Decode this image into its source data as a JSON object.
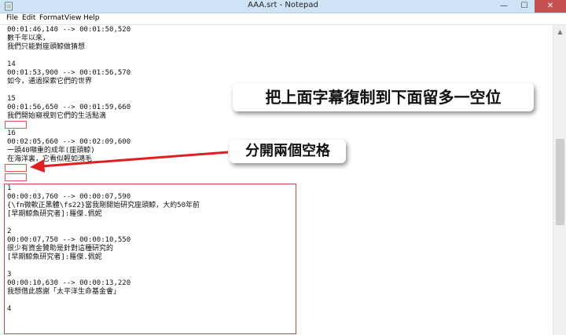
{
  "window": {
    "title": "AAA.srt - Notepad",
    "controls": {
      "minimize": "—",
      "maximize": "☐",
      "close": "✕"
    }
  },
  "menu": {
    "file": "File",
    "edit": "Edit",
    "format": "Format",
    "view": "View",
    "help": "Help"
  },
  "editor": {
    "lines": [
      "00:01:46,140 --> 00:01:50,520",
      "數千年以來，",
      "我們只能對座頭鯨做猜想",
      "",
      "14",
      "00:01:53,900 --> 00:01:56,570",
      "如今，通過探索它們的世界",
      "",
      "15",
      "00:01:56,650 --> 00:01:59,660",
      "我們開始窺視到它們的生活點滴",
      "",
      "16",
      "00:02:05,660 --> 00:02:09,600",
      "一頭40噸重的成年(座頭鯨)",
      "在海洋裏，它看似輕如鴻毛",
      "",
      "",
      "1",
      "00:00:03,760 --> 00:00:07,590",
      "{\\fn微軟正黑體\\fs22}當我剛開始研究座頭鯨，大約50年前",
      "[早期鯨魚研究者]:羅傑.佩妮",
      "",
      "2",
      "00:00:07,750 --> 00:00:10,550",
      "很少有資金贊助是針對這種研究的",
      "[早期鯨魚研究者]:羅傑.佩妮",
      "",
      "3",
      "00:00:10,630 --> 00:00:13,220",
      "我想借此感謝「太平洋生命基金會」",
      "",
      "4"
    ]
  },
  "annotations": {
    "callout_copy": "把上面字幕復制到下面留多一空位",
    "callout_separate": "分開兩個空格"
  },
  "colors": {
    "titlebar": "#cfe3f7",
    "close_button": "#c75050",
    "annotation_red": "#e02020"
  }
}
